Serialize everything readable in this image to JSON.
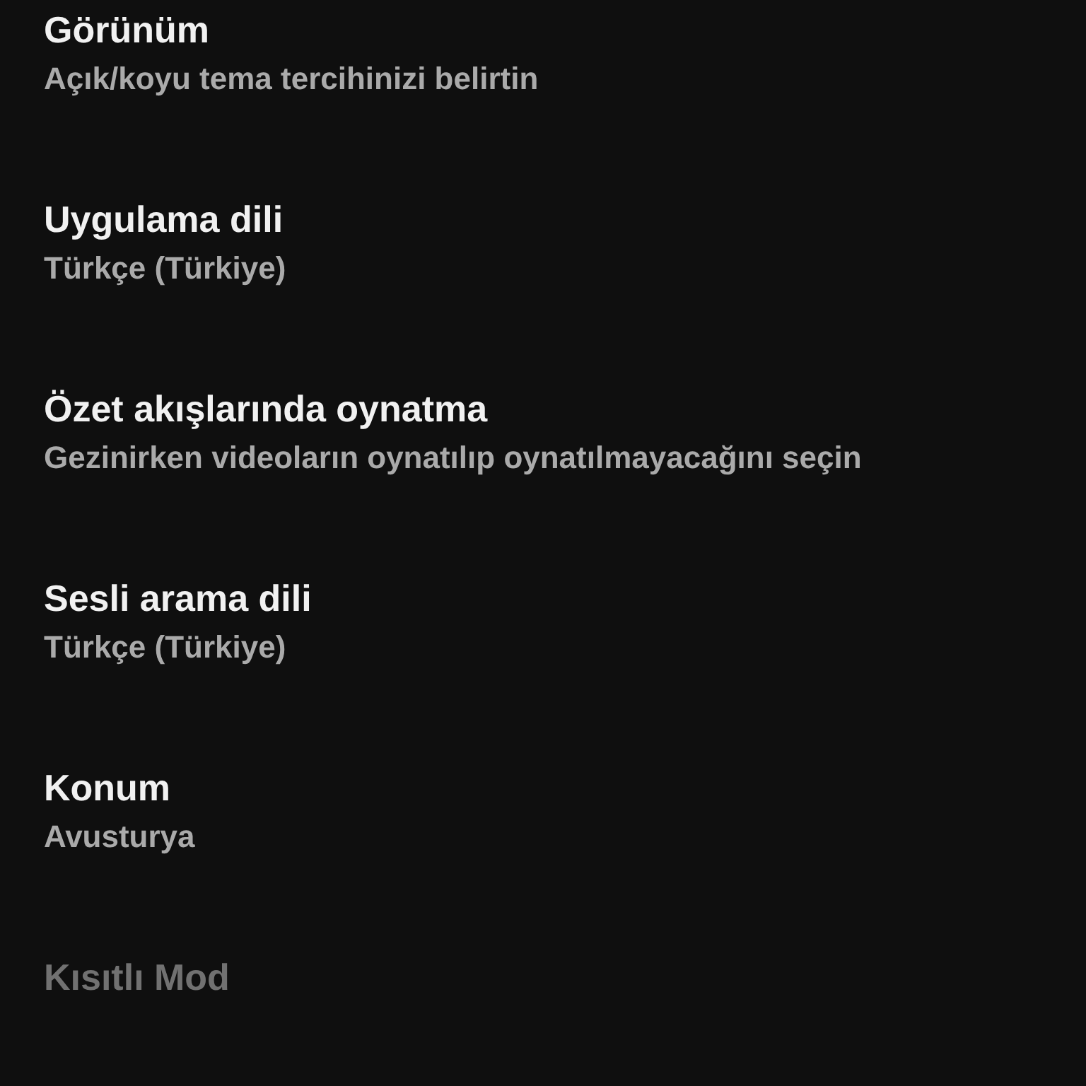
{
  "settings": [
    {
      "title": "Görünüm",
      "subtitle": "Açık/koyu tema tercihinizi belirtin",
      "disabled": false
    },
    {
      "title": "Uygulama dili",
      "subtitle": "Türkçe (Türkiye)",
      "disabled": false
    },
    {
      "title": "Özet akışlarında oynatma",
      "subtitle": "Gezinirken videoların oynatılıp oynatılmayacağını seçin",
      "disabled": false
    },
    {
      "title": "Sesli arama dili",
      "subtitle": "Türkçe (Türkiye)",
      "disabled": false
    },
    {
      "title": "Konum",
      "subtitle": "Avusturya",
      "disabled": false
    },
    {
      "title": "Kısıtlı Mod",
      "disabled": true
    }
  ]
}
